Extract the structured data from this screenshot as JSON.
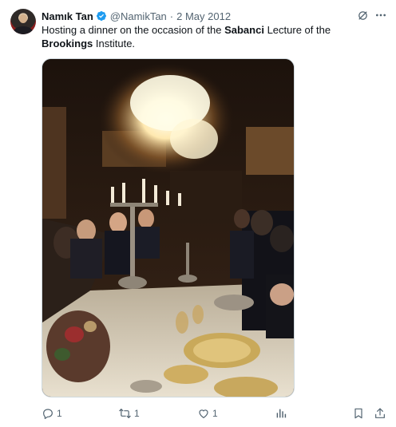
{
  "author": {
    "name": "Namık Tan",
    "handle": "@NamikTan",
    "separator": "·",
    "date": "2 May 2012"
  },
  "tweet": {
    "text_part1": "Hosting a dinner on the occasion of the ",
    "text_bold1": "Sabanci",
    "text_part2": " Lecture of the ",
    "text_bold2": "Brookings",
    "text_part3": " Institute."
  },
  "actions": {
    "reply_count": "1",
    "retweet_count": "1",
    "like_count": "1"
  },
  "icons": {
    "verified": "verified-badge-icon",
    "grok": "grok-icon",
    "more": "more-icon",
    "reply": "reply-icon",
    "retweet": "retweet-icon",
    "like": "like-icon",
    "views": "views-icon",
    "bookmark": "bookmark-icon",
    "share": "share-icon"
  },
  "colors": {
    "verified": "#1d9bf0",
    "secondary_text": "#536471",
    "primary_text": "#0f1419"
  }
}
